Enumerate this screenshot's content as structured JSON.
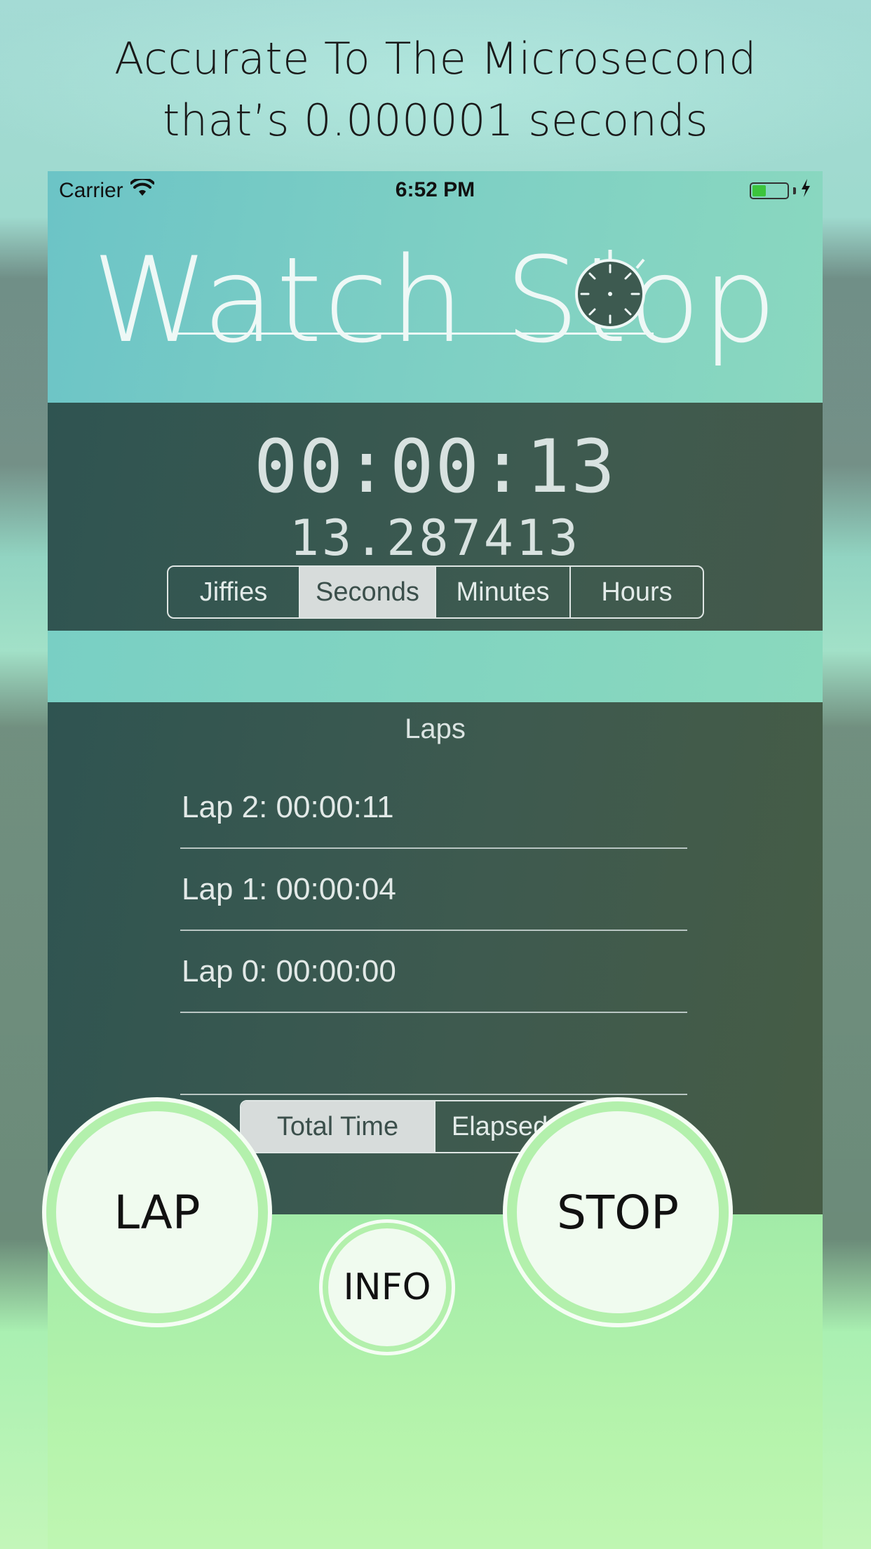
{
  "headline": {
    "line1": "Accurate To The Microsecond",
    "line2": "that’s 0.000001 seconds"
  },
  "status_bar": {
    "carrier": "Carrier",
    "time": "6:52 PM",
    "icons": [
      "wifi-icon",
      "battery-icon",
      "charging-bolt-icon"
    ]
  },
  "app": {
    "title": "Watch Stop",
    "logo_icon": "stopwatch-icon"
  },
  "timer": {
    "main": "00:00:13",
    "sub": "13.287413"
  },
  "units": {
    "options": [
      "Jiffies",
      "Seconds",
      "Minutes",
      "Hours"
    ],
    "selected": "Seconds"
  },
  "laps": {
    "title": "Laps",
    "items": [
      "Lap 2: 00:00:11",
      "Lap 1: 00:00:04",
      "Lap 0: 00:00:00",
      ""
    ]
  },
  "time_mode": {
    "options": [
      "Total Time",
      "Elapsed Time"
    ],
    "selected": "Total Time"
  },
  "buttons": {
    "lap": "LAP",
    "stop": "STOP",
    "info": "INFO"
  },
  "colors": {
    "header_band": "#7fd0c4",
    "panel_dark": "#3d5a50",
    "controls_bg": "#b4f3ab",
    "button_fill": "#f0fbef",
    "battery_fill": "#3cc43c"
  }
}
